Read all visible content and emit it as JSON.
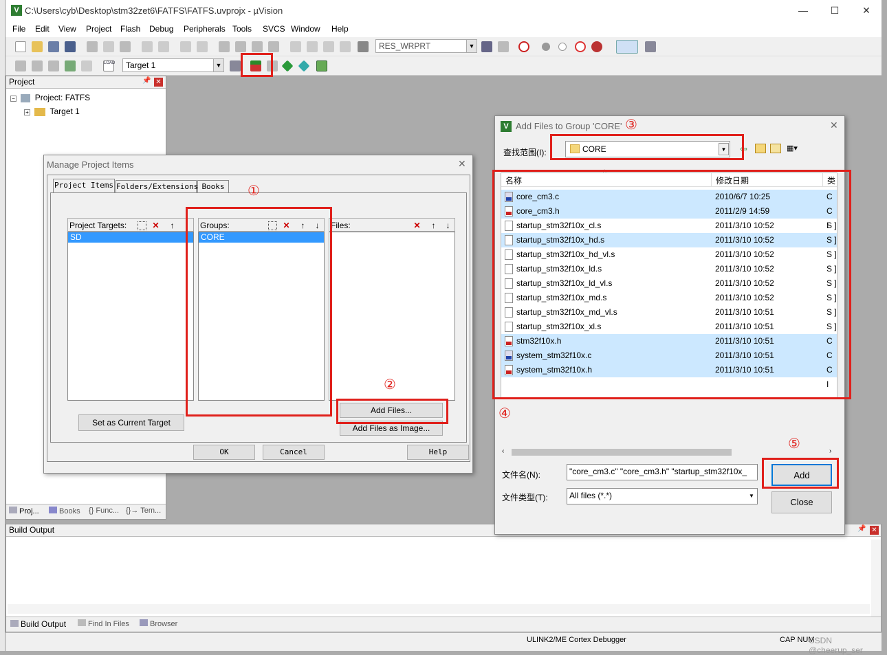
{
  "window": {
    "title": "C:\\Users\\cyb\\Desktop\\stm32zet6\\FATFS\\FATFS.uvprojx - µVision",
    "minimize": "—",
    "maximize": "☐",
    "close": "✕"
  },
  "menu": [
    "File",
    "Edit",
    "View",
    "Project",
    "Flash",
    "Debug",
    "Peripherals",
    "Tools",
    "SVCS",
    "Window",
    "Help"
  ],
  "toolbar": {
    "find_combo": "RES_WRPRT",
    "load_label": "LOAD",
    "target_combo": "Target 1"
  },
  "project_pane": {
    "title": "Project",
    "tree": {
      "root": "Project: FATFS",
      "child": "Target 1"
    },
    "tabs": [
      "Proj...",
      "Books",
      "{} Func...",
      "{}→ Tem..."
    ]
  },
  "build_pane": {
    "title": "Build Output",
    "tabs": [
      "Build Output",
      "Find In Files",
      "Browser"
    ]
  },
  "status": {
    "debugger": "ULINK2/ME Cortex Debugger",
    "caps": "CAP NUM",
    "watermark": "CSDN @cheerup_ser"
  },
  "manage_dialog": {
    "title": "Manage Project Items",
    "tabs": [
      "Project Items",
      "Folders/Extensions",
      "Books"
    ],
    "targets_label": "Project Targets:",
    "targets": [
      "SD"
    ],
    "groups_label": "Groups:",
    "groups": [
      "CORE"
    ],
    "files_label": "Files:",
    "set_current": "Set as Current Target",
    "add_files": "Add Files...",
    "add_files_image": "Add Files as Image...",
    "ok": "OK",
    "cancel": "Cancel",
    "help": "Help"
  },
  "add_dialog": {
    "title": "Add Files to Group 'CORE'",
    "lookin_label": "查找范围(I):",
    "lookin_value": "CORE",
    "col_name": "名称",
    "col_date": "修改日期",
    "col_type": "类",
    "files": [
      {
        "name": "core_cm3.c",
        "date": "2010/6/7 10:25",
        "type": "C S",
        "kind": "c",
        "selected": true
      },
      {
        "name": "core_cm3.h",
        "date": "2011/2/9 14:59",
        "type": "C I",
        "kind": "h",
        "selected": true
      },
      {
        "name": "startup_stm32f10x_cl.s",
        "date": "2011/3/10 10:52",
        "type": "S ]",
        "kind": "s",
        "selected": false
      },
      {
        "name": "startup_stm32f10x_hd.s",
        "date": "2011/3/10 10:52",
        "type": "S ]",
        "kind": "s",
        "selected": true
      },
      {
        "name": "startup_stm32f10x_hd_vl.s",
        "date": "2011/3/10 10:52",
        "type": "S ]",
        "kind": "s",
        "selected": false
      },
      {
        "name": "startup_stm32f10x_ld.s",
        "date": "2011/3/10 10:52",
        "type": "S ]",
        "kind": "s",
        "selected": false
      },
      {
        "name": "startup_stm32f10x_ld_vl.s",
        "date": "2011/3/10 10:52",
        "type": "S ]",
        "kind": "s",
        "selected": false
      },
      {
        "name": "startup_stm32f10x_md.s",
        "date": "2011/3/10 10:52",
        "type": "S ]",
        "kind": "s",
        "selected": false
      },
      {
        "name": "startup_stm32f10x_md_vl.s",
        "date": "2011/3/10 10:51",
        "type": "S ]",
        "kind": "s",
        "selected": false
      },
      {
        "name": "startup_stm32f10x_xl.s",
        "date": "2011/3/10 10:51",
        "type": "S ]",
        "kind": "s",
        "selected": false
      },
      {
        "name": "stm32f10x.h",
        "date": "2011/3/10 10:51",
        "type": "C I",
        "kind": "h",
        "selected": true
      },
      {
        "name": "system_stm32f10x.c",
        "date": "2011/3/10 10:51",
        "type": "C S",
        "kind": "c",
        "selected": true
      },
      {
        "name": "system_stm32f10x.h",
        "date": "2011/3/10 10:51",
        "type": "C I",
        "kind": "h",
        "selected": true
      }
    ],
    "filename_label": "文件名(N):",
    "filename_value": "\"core_cm3.c\" \"core_cm3.h\" \"startup_stm32f10x_",
    "filetype_label": "文件类型(T):",
    "filetype_value": "All files (*.*)",
    "add": "Add",
    "close": "Close"
  },
  "annotations": [
    "①",
    "②",
    "③",
    "④",
    "⑤"
  ],
  "colors": {
    "highlight": "#e0201b",
    "selection": "#3399ff",
    "row_selected": "#cce8ff"
  }
}
